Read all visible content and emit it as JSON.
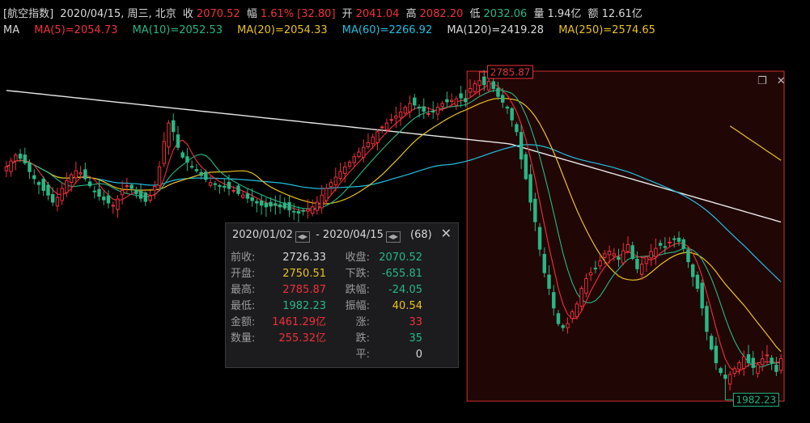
{
  "header": {
    "name": "[航空指数]",
    "date": "2020/04/15, 周三, 北京",
    "close_label": "收",
    "close": "2070.52",
    "change_label": "幅",
    "change_pct": "1.61%",
    "change_abs": "[32.80]",
    "open_label": "开",
    "open": "2041.04",
    "high_label": "高",
    "high": "2082.20",
    "low_label": "低",
    "low": "2032.06",
    "volume_label": "量",
    "volume": "1.94亿",
    "amount_label": "额",
    "amount": "12.61亿"
  },
  "ma_legend": {
    "title": "MA",
    "items": [
      {
        "text": "MA(5)=2054.73",
        "color": "#f0303a"
      },
      {
        "text": "MA(10)=2052.53",
        "color": "#28b785"
      },
      {
        "text": "MA(20)=2054.33",
        "color": "#e8c220"
      },
      {
        "text": "MA(60)=2266.92",
        "color": "#22c0e0"
      },
      {
        "text": "MA(120)=2419.28",
        "color": "#d8d8d8"
      },
      {
        "text": "MA(250)=2574.65",
        "color": "#e8c220"
      }
    ]
  },
  "chart_data": {
    "type": "candlestick",
    "note_marks": {
      "high": "2785.87",
      "low": "1982.23"
    },
    "selection": {
      "start": "2020/01/02",
      "end": "2020/04/15"
    },
    "colors": {
      "up": "#f0303a",
      "down": "#28b785",
      "ma5": "#f0303a",
      "ma10": "#28b785",
      "ma20": "#e8c220",
      "ma60": "#22c0e0",
      "ma120": "#e8e8e8",
      "ma250": "#e8c220",
      "selection_border": "#d0302c"
    },
    "pre_period_close": [
      2560,
      2575,
      2590,
      2582,
      2570,
      2548,
      2530,
      2515,
      2500,
      2488,
      2470,
      2482,
      2505,
      2525,
      2540,
      2550,
      2545,
      2530,
      2512,
      2498,
      2485,
      2476,
      2468,
      2462,
      2478,
      2500,
      2512,
      2505,
      2492,
      2480,
      2472,
      2486,
      2510,
      2560,
      2625,
      2672,
      2650,
      2610,
      2585,
      2572,
      2560,
      2550,
      2538,
      2528,
      2520,
      2515,
      2512,
      2508,
      2505,
      2500,
      2492,
      2488,
      2480,
      2474,
      2468,
      2462,
      2458,
      2460,
      2462,
      2458,
      2455,
      2450,
      2446,
      2442,
      2448,
      2452,
      2458,
      2470,
      2488,
      2505,
      2520,
      2534,
      2548,
      2560,
      2572,
      2586,
      2598,
      2610,
      2622,
      2636,
      2650,
      2662,
      2672,
      2681,
      2690,
      2700,
      2712,
      2722,
      2718,
      2710,
      2702,
      2696,
      2700,
      2712,
      2722,
      2726,
      2730,
      2734,
      2736,
      2726.33
    ],
    "period_close": [
      2760,
      2772,
      2780,
      2770,
      2778,
      2760,
      2740,
      2725,
      2710,
      2680,
      2650,
      2580,
      2530,
      2470,
      2420,
      2350,
      2290,
      2250,
      2200,
      2160,
      2150,
      2160,
      2190,
      2210,
      2250,
      2275,
      2290,
      2300,
      2320,
      2338,
      2345,
      2338,
      2324,
      2346,
      2362,
      2326,
      2300,
      2312,
      2330,
      2344,
      2352,
      2360,
      2356,
      2368,
      2376,
      2370,
      2352,
      2318,
      2280,
      2250,
      2200,
      2140,
      2095,
      2060,
      2035,
      2020,
      2030,
      2045,
      2060,
      2075,
      2060,
      2048,
      2055,
      2070,
      2080,
      2060,
      2037.72,
      2070.52
    ]
  },
  "popup": {
    "start": "2020/01/02",
    "dash": "-",
    "end": "2020/04/15",
    "count": "(68)",
    "close_icon": "✕",
    "rows": [
      {
        "l1": "前收:",
        "v1": "2726.33",
        "c1": "#d8d8d8",
        "l2": "收盘:",
        "v2": "2070.52",
        "c2": "#28b785"
      },
      {
        "l1": "开盘:",
        "v1": "2750.51",
        "c1": "#e8c220",
        "l2": "下跌:",
        "v2": "-655.81",
        "c2": "#28b785"
      },
      {
        "l1": "最高:",
        "v1": "2785.87",
        "c1": "#f0303a",
        "l2": "跌幅:",
        "v2": "-24.05",
        "c2": "#28b785"
      },
      {
        "l1": "最低:",
        "v1": "1982.23",
        "c1": "#28b785",
        "l2": "振幅:",
        "v2": "40.54",
        "c2": "#e8c220"
      },
      {
        "l1": "金额:",
        "v1": "1461.29亿",
        "c1": "#f0303a",
        "l2": "涨:",
        "v2": "33",
        "c2": "#f0303a"
      },
      {
        "l1": "数量:",
        "v1": "255.32亿",
        "c1": "#f0303a",
        "l2": "跌:",
        "v2": "35",
        "c2": "#28b785"
      },
      {
        "l1": "",
        "v1": "",
        "c1": "#d8d8d8",
        "l2": "平:",
        "v2": "0",
        "c2": "#d8d8d8"
      }
    ]
  },
  "window_buttons": {
    "restore_icon": "restore-icon",
    "close_icon": "close-icon",
    "restore_glyph": "❐",
    "close_glyph": "✕"
  }
}
